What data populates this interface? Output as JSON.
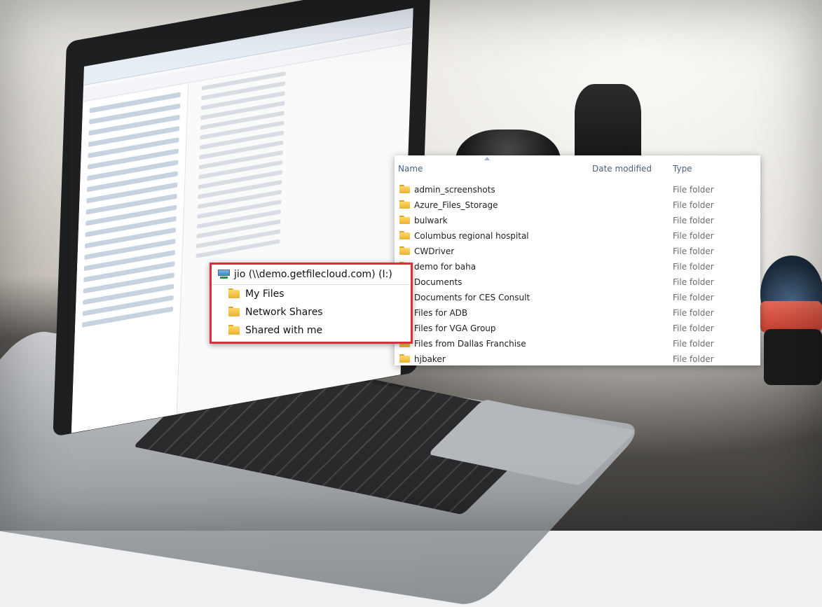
{
  "file_list": {
    "columns": {
      "name": "Name",
      "date_modified": "Date modified",
      "type": "Type"
    },
    "rows": [
      {
        "name": "admin_screenshots",
        "type": "File folder"
      },
      {
        "name": "Azure_Files_Storage",
        "type": "File folder"
      },
      {
        "name": "bulwark",
        "type": "File folder"
      },
      {
        "name": "Columbus regional hospital",
        "type": "File folder"
      },
      {
        "name": "CWDriver",
        "type": "File folder"
      },
      {
        "name": "demo for baha",
        "type": "File folder"
      },
      {
        "name": "Documents",
        "type": "File folder"
      },
      {
        "name": "Documents for CES Consult",
        "type": "File folder"
      },
      {
        "name": "Files for ADB",
        "type": "File folder"
      },
      {
        "name": "Files for VGA Group",
        "type": "File folder"
      },
      {
        "name": "Files from Dallas Franchise",
        "type": "File folder"
      },
      {
        "name": "hjbaker",
        "type": "File folder"
      }
    ]
  },
  "nav_popup": {
    "drive_label": "jio (\\\\demo.getfilecloud.com) (I:)",
    "items": [
      {
        "label": "My Files"
      },
      {
        "label": "Network Shares"
      },
      {
        "label": "Shared with me"
      }
    ],
    "border_color": "#d9303a"
  },
  "icons": {
    "folder": "folder-icon",
    "drive": "network-drive-icon",
    "sort": "sort-ascending-icon"
  }
}
